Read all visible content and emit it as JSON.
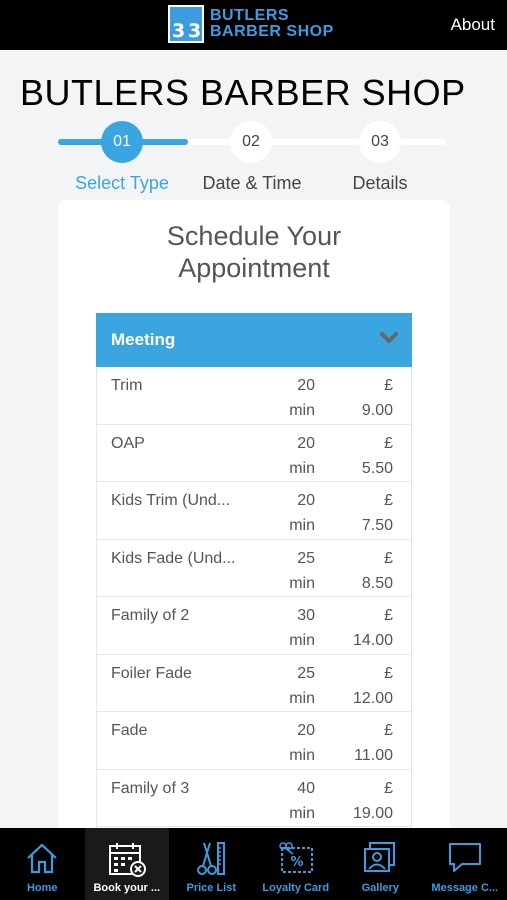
{
  "header": {
    "logo_mark": "BB",
    "logo_line1": "BUTLERS",
    "logo_line2": "BARBER SHOP",
    "about_label": "About"
  },
  "page": {
    "title": "BUTLERS BARBER SHOP"
  },
  "stepper": {
    "steps": [
      {
        "number": "01",
        "label": "Select Type",
        "active": true
      },
      {
        "number": "02",
        "label": "Date & Time",
        "active": false
      },
      {
        "number": "03",
        "label": "Details",
        "active": false
      }
    ]
  },
  "card": {
    "title_line1": "Schedule Your",
    "title_line2": "Appointment",
    "select_value": "Meeting",
    "services": [
      {
        "name": "Trim",
        "duration": "20",
        "unit": "min",
        "currency": "£",
        "price": "9.00"
      },
      {
        "name": "OAP",
        "duration": "20",
        "unit": "min",
        "currency": "£",
        "price": "5.50"
      },
      {
        "name": "Kids Trim (Und...",
        "duration": "20",
        "unit": "min",
        "currency": "£",
        "price": "7.50"
      },
      {
        "name": "Kids Fade (Und...",
        "duration": "25",
        "unit": "min",
        "currency": "£",
        "price": "8.50"
      },
      {
        "name": "Family of 2",
        "duration": "30",
        "unit": "min",
        "currency": "£",
        "price": "14.00"
      },
      {
        "name": "Foiler Fade",
        "duration": "25",
        "unit": "min",
        "currency": "£",
        "price": "12.00"
      },
      {
        "name": "Fade",
        "duration": "20",
        "unit": "min",
        "currency": "£",
        "price": "11.00"
      },
      {
        "name": "Family of 3",
        "duration": "40",
        "unit": "min",
        "currency": "£",
        "price": "19.00"
      },
      {
        "name": "",
        "duration": "",
        "unit": "",
        "currency": "",
        "price": ""
      }
    ]
  },
  "bottom_nav": {
    "items": [
      {
        "label": "Home",
        "icon": "home-icon"
      },
      {
        "label": "Book your ...",
        "icon": "calendar-icon",
        "active": true
      },
      {
        "label": "Price List",
        "icon": "scissors-comb-icon"
      },
      {
        "label": "Loyalty Card",
        "icon": "loyalty-card-icon"
      },
      {
        "label": "Gallery",
        "icon": "gallery-icon"
      },
      {
        "label": "Message C...",
        "icon": "chat-icon"
      }
    ]
  },
  "colors": {
    "accent": "#3aa5df",
    "nav_icon": "#3b9de0",
    "bar": "#000000"
  }
}
